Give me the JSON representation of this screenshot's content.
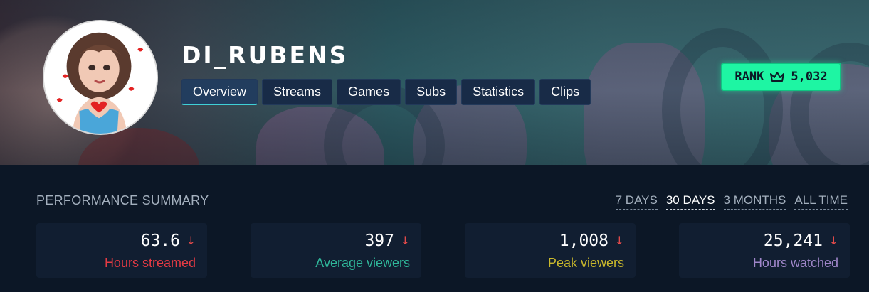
{
  "channel": {
    "name": "DI_RUBENS"
  },
  "tabs": [
    {
      "label": "Overview",
      "active": true
    },
    {
      "label": "Streams",
      "active": false
    },
    {
      "label": "Games",
      "active": false
    },
    {
      "label": "Subs",
      "active": false
    },
    {
      "label": "Statistics",
      "active": false
    },
    {
      "label": "Clips",
      "active": false
    }
  ],
  "rank": {
    "label": "RANK",
    "icon": "crown-icon",
    "value": "5,032",
    "color": "#1ef5a3"
  },
  "performance": {
    "title": "PERFORMANCE SUMMARY",
    "ranges": [
      {
        "label": "7 DAYS",
        "active": false
      },
      {
        "label": "30 DAYS",
        "active": true
      },
      {
        "label": "3 MONTHS",
        "active": false
      },
      {
        "label": "ALL TIME",
        "active": false
      }
    ],
    "stats": [
      {
        "value": "63.6",
        "trend": "↓",
        "label": "Hours streamed",
        "color": "#e53b44"
      },
      {
        "value": "397",
        "trend": "↓",
        "label": "Average viewers",
        "color": "#2fb79a"
      },
      {
        "value": "1,008",
        "trend": "↓",
        "label": "Peak viewers",
        "color": "#c9b82c"
      },
      {
        "value": "25,241",
        "trend": "↓",
        "label": "Hours watched",
        "color": "#9f86c9"
      }
    ]
  }
}
